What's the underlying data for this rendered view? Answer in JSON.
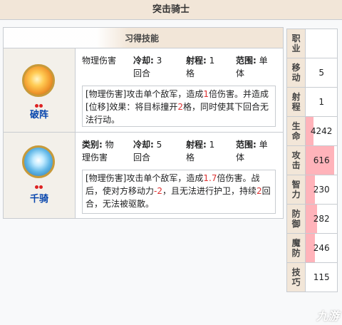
{
  "title": "突击骑士",
  "skills_header": "习得技能",
  "labels": {
    "type": "类别:",
    "cooldown": "冷却:",
    "range": "射程:",
    "area": "范围:"
  },
  "skills": [
    {
      "name": "破阵",
      "type": "物理伤害",
      "cooldown": "3回合",
      "range": "1格",
      "area": "单体",
      "desc_a": "[物理伤害]攻击单个敌军，造成",
      "desc_b": "1",
      "desc_c": "倍伤害。并造成[位移]效果：将目标撞开",
      "desc_d": "2",
      "desc_e": "格，同时使其下回合无法行动。"
    },
    {
      "name": "千骑",
      "type": "物理伤害",
      "cooldown": "5回合",
      "range": "1格",
      "area": "单体",
      "desc_a": "[物理伤害]攻击单个敌军，造成",
      "desc_b": "1.7",
      "desc_c": "倍伤害。战后，使对方移动力",
      "desc_d": "-2",
      "desc_e": "，且无法进行护卫，持续",
      "desc_f": "2",
      "desc_g": "回合，无法被驱散。"
    }
  ],
  "stats": [
    {
      "key": "职业",
      "value": "",
      "fill": 0
    },
    {
      "key": "移动",
      "value": "5",
      "fill": 0
    },
    {
      "key": "射程",
      "value": "1",
      "fill": 0
    },
    {
      "key": "生命",
      "value": "4242",
      "fill": 0.25
    },
    {
      "key": "攻击",
      "value": "616",
      "fill": 0.9
    },
    {
      "key": "智力",
      "value": "230",
      "fill": 0.3
    },
    {
      "key": "防御",
      "value": "282",
      "fill": 0.35
    },
    {
      "key": "魔防",
      "value": "246",
      "fill": 0.3
    },
    {
      "key": "技巧",
      "value": "115",
      "fill": 0
    }
  ],
  "watermark": "九游",
  "colors": {
    "header_bg": "#f2e6d8",
    "link": "#0645ad",
    "highlight": "#d33",
    "bar": "#ffb3ba"
  }
}
